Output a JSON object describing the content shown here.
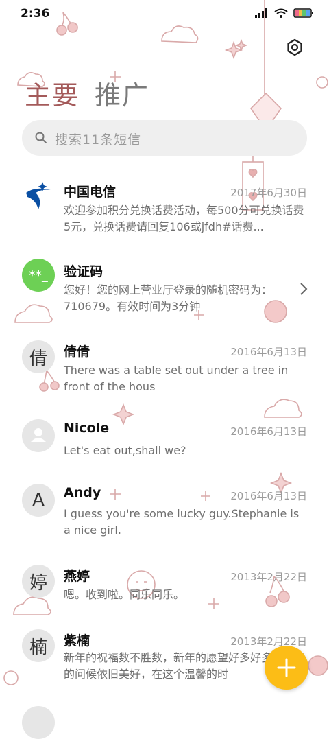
{
  "status_bar": {
    "time": "2:36"
  },
  "tabs": [
    {
      "label": "主要",
      "active": true
    },
    {
      "label": "推广",
      "active": false
    }
  ],
  "search": {
    "placeholder": "搜索11条短信"
  },
  "colors": {
    "accent": "#a45a5a",
    "fab": "#fcbd16",
    "verification_avatar": "#6dd055",
    "telecom_blue": "#0a4fa3"
  },
  "conversations": [
    {
      "name": "中国电信",
      "date": "2017年6月30日",
      "preview": "欢迎参加积分兑换话费活动，每500分可兑换话费5元，兑换话费请回复106或jfdh#话费...",
      "avatar": "china-telecom-logo"
    },
    {
      "name": "验证码",
      "date": "",
      "preview": "您好！您的网上营业厅登录的随机密码为：710679。有效时间为3分钟",
      "avatar_text": "**_"
    },
    {
      "name": "倩倩",
      "date": "2016年6月13日",
      "preview": "There was a table set out under a tree in front of the hous",
      "avatar_text": "倩"
    },
    {
      "name": "Nicole",
      "date": "2016年6月13日",
      "preview": "Let's eat out,shall we?",
      "avatar": "person-icon"
    },
    {
      "name": "Andy",
      "date": "2016年6月13日",
      "preview": "I guess you're some lucky guy.Stephanie is a nice girl.",
      "avatar_text": "A"
    },
    {
      "name": "燕婷",
      "date": "2013年2月22日",
      "preview": "嗯。收到啦。同乐同乐。",
      "avatar_text": "婷"
    },
    {
      "name": "紫楠",
      "date": "2013年2月22日",
      "preview": "新年的祝福数不胜数，新年的愿望好多好多，新年的问候依旧美好，在这个温馨的时",
      "avatar_text": "楠"
    }
  ]
}
